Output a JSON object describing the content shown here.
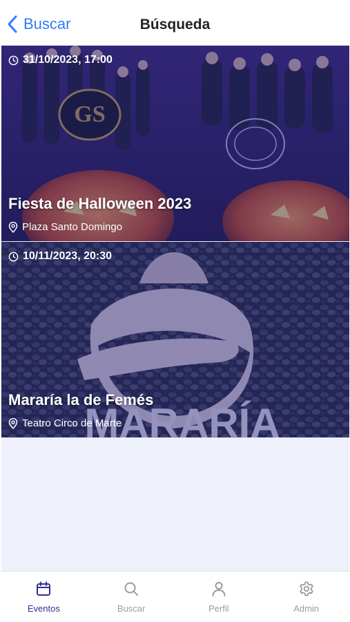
{
  "nav": {
    "back_label": "Buscar",
    "title": "Búsqueda"
  },
  "events": [
    {
      "date": "31/10/2023, 17:00",
      "title": "Fiesta de Halloween 2023",
      "location": "Plaza Santo Domingo"
    },
    {
      "date": "10/11/2023, 20:30",
      "title": "Mararía la de Femés",
      "location": "Teatro Circo de Marte"
    }
  ],
  "tabs": [
    {
      "label": "Eventos",
      "icon": "calendar-icon",
      "active": true
    },
    {
      "label": "Buscar",
      "icon": "search-icon",
      "active": false
    },
    {
      "label": "Perfil",
      "icon": "person-icon",
      "active": false
    },
    {
      "label": "Admin",
      "icon": "gear-icon",
      "active": false
    }
  ],
  "colors": {
    "accent": "#2f7cf6",
    "active_tab": "#2f3190",
    "inactive_tab": "#9b9b9b",
    "list_bg": "#eef0fb"
  }
}
